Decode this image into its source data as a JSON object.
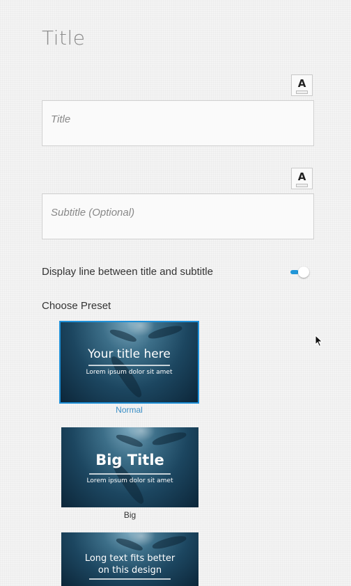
{
  "page": {
    "heading": "Title"
  },
  "title_field": {
    "placeholder": "Title",
    "format_icon": "A"
  },
  "subtitle_field": {
    "placeholder": "Subtitle (Optional)",
    "format_icon": "A"
  },
  "toggle": {
    "label": "Display line between title and subtitle",
    "on": true
  },
  "presets": {
    "label": "Choose Preset",
    "items": [
      {
        "title": "Your title here",
        "subtitle": "Lorem ipsum dolor sit amet",
        "caption": "Normal",
        "selected": true
      },
      {
        "title": "Big Title",
        "subtitle": "Lorem ipsum dolor sit amet",
        "caption": "Big",
        "selected": false
      },
      {
        "title_line1": "Long text fits better",
        "title_line2": "on this design",
        "selected": false
      }
    ]
  },
  "colors": {
    "accent": "#1e90d8",
    "caption_selected": "#3b8fc6"
  }
}
